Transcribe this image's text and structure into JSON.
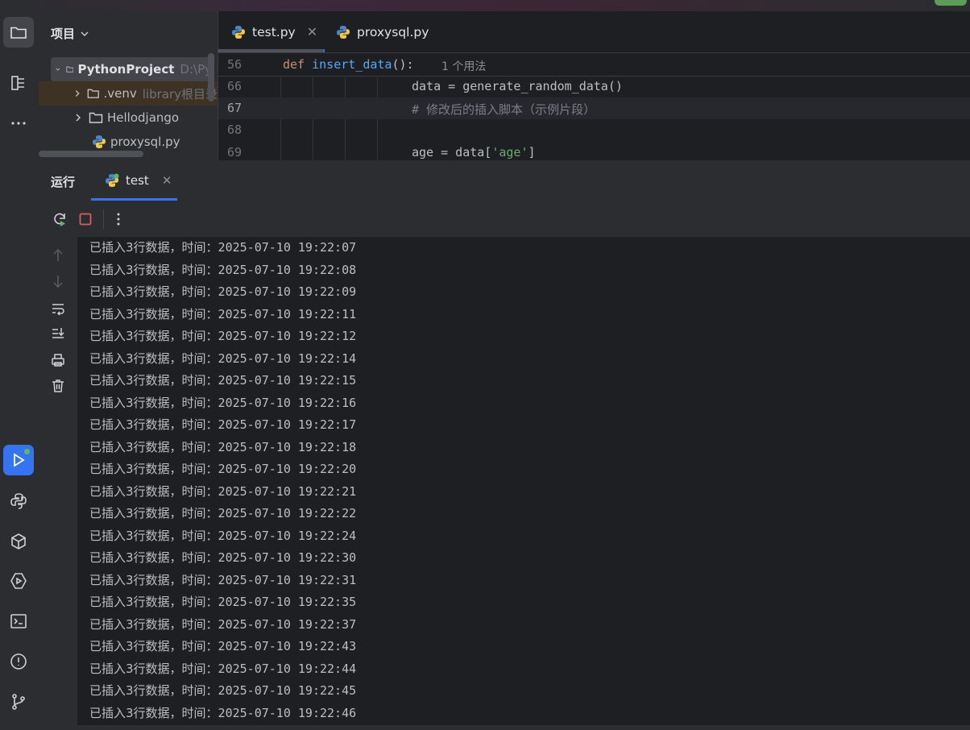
{
  "project_panel": {
    "title": "项目",
    "root": {
      "name": "PythonProject",
      "path": "D:\\Py"
    },
    "items": [
      {
        "name": ".venv",
        "hint": "library根目录"
      },
      {
        "name": "Hellodjango",
        "hint": ""
      },
      {
        "name": "proxysql.py",
        "hint": ""
      }
    ]
  },
  "editor": {
    "tabs": [
      {
        "label": "test.py",
        "active": true
      },
      {
        "label": "proxysql.py",
        "active": false
      }
    ],
    "lines": [
      {
        "num": "56",
        "usage_hint": "1 个用法"
      },
      {
        "num": "66",
        "text": "data = generate_random_data()"
      },
      {
        "num": "67",
        "text": "# 修改后的插入脚本（示例片段）"
      },
      {
        "num": "68",
        "text": ""
      },
      {
        "num": "69",
        "text_pre": "age = data[",
        "text_str": "'age'",
        "text_post": "]"
      }
    ],
    "def_keyword": "def",
    "def_name": "insert_data",
    "def_tail": "():"
  },
  "run_window": {
    "title": "运行",
    "tab_label": "test",
    "log_prefix": "已插入3行数据，时间：",
    "log_times": [
      "2025-07-10 19:22:07",
      "2025-07-10 19:22:08",
      "2025-07-10 19:22:09",
      "2025-07-10 19:22:11",
      "2025-07-10 19:22:12",
      "2025-07-10 19:22:14",
      "2025-07-10 19:22:15",
      "2025-07-10 19:22:16",
      "2025-07-10 19:22:17",
      "2025-07-10 19:22:18",
      "2025-07-10 19:22:20",
      "2025-07-10 19:22:21",
      "2025-07-10 19:22:22",
      "2025-07-10 19:22:24",
      "2025-07-10 19:22:30",
      "2025-07-10 19:22:31",
      "2025-07-10 19:22:35",
      "2025-07-10 19:22:37",
      "2025-07-10 19:22:43",
      "2025-07-10 19:22:44",
      "2025-07-10 19:22:45",
      "2025-07-10 19:22:46"
    ]
  },
  "activity_bar": [
    "folder-icon",
    "structure-icon",
    "more-icon",
    "run-icon",
    "python-console-icon",
    "python-packages-icon",
    "services-icon",
    "terminal-icon",
    "problems-icon",
    "git-icon"
  ],
  "colors": {
    "accent": "#3574f0",
    "stop": "#db5c5c",
    "run_green": "#5fb865"
  }
}
